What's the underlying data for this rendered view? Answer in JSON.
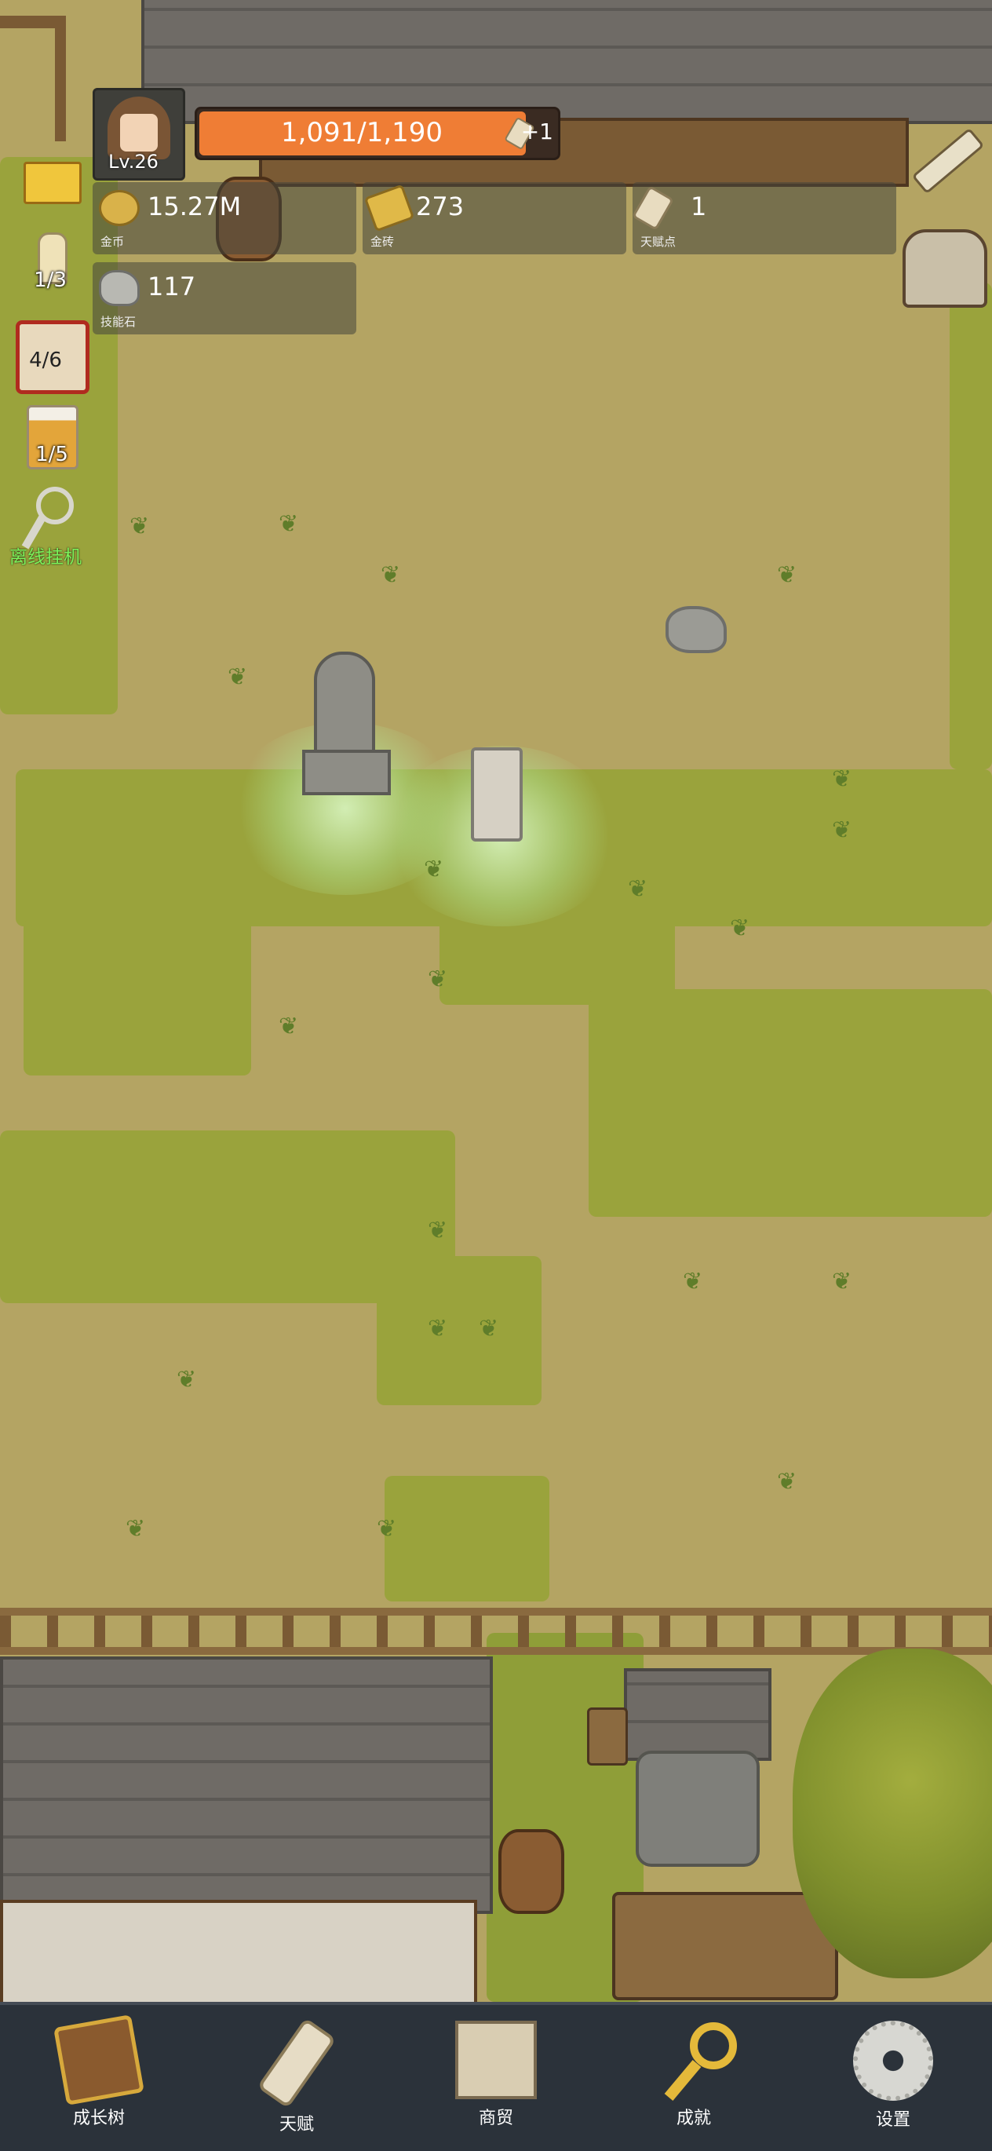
{
  "player": {
    "level": "Lv.26",
    "exp_text": "1,091/1,190",
    "exp_fraction": 0.917,
    "exp_bonus": "+1"
  },
  "resources": [
    {
      "icon": "gold-coin-icon",
      "value": "15.27M",
      "label": "金币"
    },
    {
      "icon": "gold-brick-icon",
      "value": "273",
      "label": "金砖"
    },
    {
      "icon": "talent-scroll-icon",
      "value": "1",
      "label": "天赋点"
    },
    {
      "icon": "skill-stone-icon",
      "value": "117",
      "label": "技能石"
    }
  ],
  "left_items": {
    "candle_count": "1/3",
    "dice_count": "4/6",
    "beer_count": "1/5",
    "idle_label": "离线挂机"
  },
  "nav": [
    {
      "icon": "book-icon",
      "label": "成长树"
    },
    {
      "icon": "scroll-icon",
      "label": "天赋"
    },
    {
      "icon": "map-icon",
      "label": "商贸"
    },
    {
      "icon": "key-icon",
      "label": "成就"
    },
    {
      "icon": "gear-icon",
      "label": "设置"
    }
  ],
  "colors": {
    "exp_bar": "#ef7d35",
    "idle_text": "#7cf25a",
    "nav_bg": "#2b323a"
  }
}
